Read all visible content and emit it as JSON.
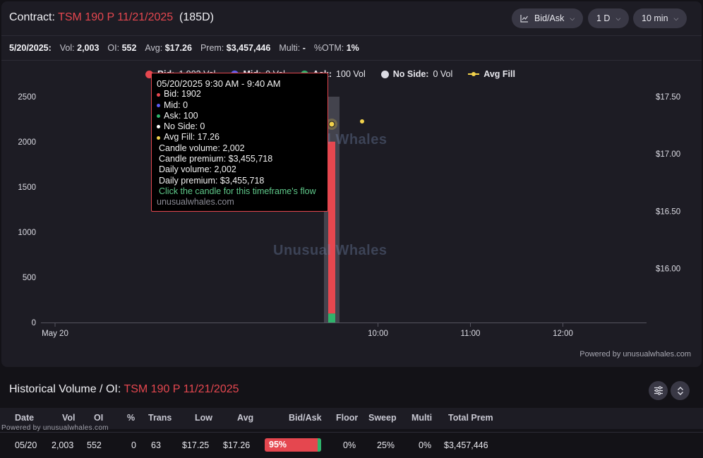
{
  "header": {
    "label": "Contract:",
    "contract": "TSM 190 P 11/21/2025",
    "dte": "(185D)",
    "controls": {
      "bidask": "Bid/Ask",
      "range": "1 D",
      "interval": "10 min"
    }
  },
  "stats": {
    "date": "5/20/2025:",
    "vol_label": "Vol:",
    "vol": "2,003",
    "oi_label": "OI:",
    "oi": "552",
    "avg_label": "Avg:",
    "avg": "$17.26",
    "prem_label": "Prem:",
    "prem": "$3,457,446",
    "multi_label": "Multi:",
    "multi": "-",
    "otm_label": "%OTM:",
    "otm": "1%"
  },
  "legend": [
    {
      "name": "Bid:",
      "value": "1,903 Vol",
      "color": "#e5474f"
    },
    {
      "name": "Mid:",
      "value": "0 Vol",
      "color": "#5b5bf0"
    },
    {
      "name": "Ask:",
      "value": "100 Vol",
      "color": "#2fb36b"
    },
    {
      "name": "No Side:",
      "value": "0 Vol",
      "color": "#dcdce4"
    },
    {
      "name": "Avg Fill",
      "value": "",
      "color": "#f2d24b"
    }
  ],
  "watermark": "Unusual Whales",
  "powered": "Powered by unusualwhales.com",
  "chart_data": {
    "type": "bar",
    "x_ticks": [
      "May 20",
      "10:00",
      "11:00",
      "12:00"
    ],
    "y_left_ticks": [
      "0",
      "500",
      "1000",
      "1500",
      "2000",
      "2500"
    ],
    "y_right_ticks": [
      "$16.00",
      "$16.50",
      "$17.00",
      "$17.50"
    ],
    "ylim_left": [
      0,
      2500
    ],
    "series": [
      {
        "name": "Bid",
        "values": [
          1902
        ]
      },
      {
        "name": "Mid",
        "values": [
          0
        ]
      },
      {
        "name": "Ask",
        "values": [
          100
        ]
      },
      {
        "name": "No Side",
        "values": [
          0
        ]
      }
    ],
    "avg_fill": [
      17.26,
      17.26
    ],
    "categories": [
      "9:30 AM"
    ]
  },
  "tooltip": {
    "title": "05/20/2025 9:30 AM - 9:40 AM",
    "bid": "Bid: 1902",
    "mid": "Mid: 0",
    "ask": "Ask: 100",
    "noside": "No Side: 0",
    "avgfill": "Avg Fill: 17.26",
    "candle_volume": "Candle volume: 2,002",
    "candle_premium": "Candle premium: $3,455,718",
    "daily_volume": "Daily volume: 2,002",
    "daily_premium": "Daily premium: $3,455,718",
    "link": "Click the candle for this timeframe's flow",
    "site": "unusualwhales.com"
  },
  "history": {
    "title_label": "Historical Volume / OI:",
    "contract": "TSM 190 P 11/21/2025",
    "powered": "Powered by unusualwhales.com",
    "columns": [
      "Date",
      "Vol",
      "OI",
      "%",
      "Trans",
      "Low",
      "Avg",
      "Bid/Ask",
      "Floor",
      "Sweep",
      "Multi",
      "Total Prem"
    ],
    "row": {
      "date": "05/20",
      "vol": "2,003",
      "oi": "552",
      "pct": "0",
      "trans": "63",
      "low": "$17.25",
      "avg": "$17.26",
      "bidask": "95%",
      "bidask_fraction": 0.95,
      "floor": "0%",
      "sweep": "25%",
      "multi": "0%",
      "total_prem": "$3,457,446"
    }
  }
}
